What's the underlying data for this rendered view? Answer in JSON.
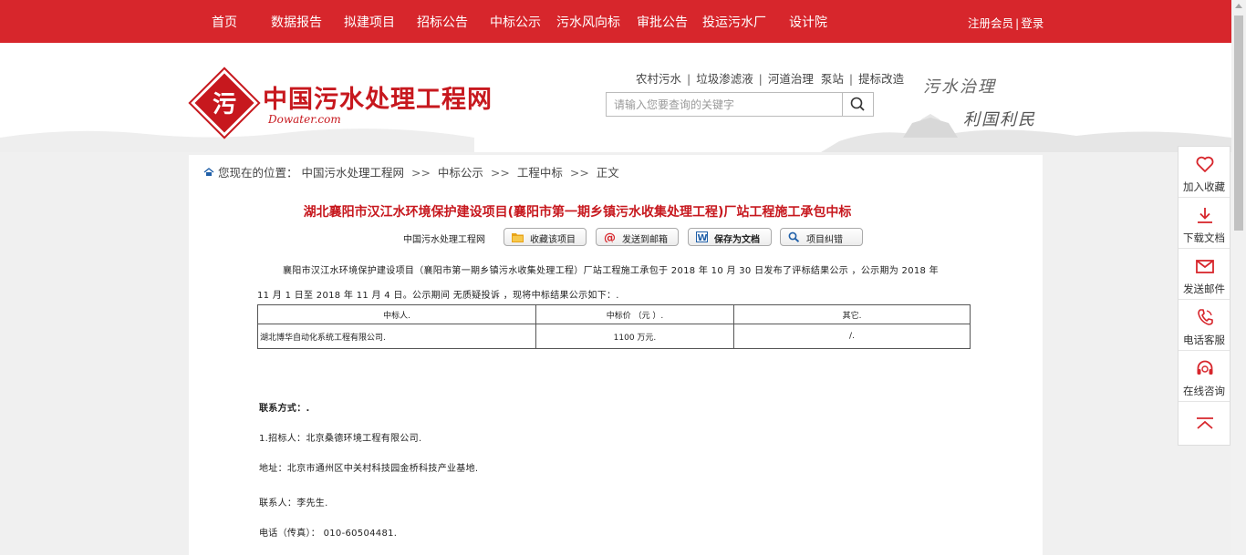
{
  "nav": {
    "items": [
      "首页",
      "数据报告",
      "拟建项目",
      "招标公告",
      "中标公示",
      "污水风向标",
      "审批公告",
      "投运污水厂",
      "设计院"
    ],
    "register": "注册会员",
    "sep": "|",
    "login": "登录"
  },
  "header": {
    "logo_char": "污",
    "site_name": "中国污水处理工程网",
    "domain": "Dowater.com",
    "quick_links": [
      "农村污水",
      "垃圾渗滤液",
      "河道治理",
      "泵站",
      "提标改造"
    ],
    "search_placeholder": "请输入您要查询的关键字",
    "slogan_line1": "污水治理",
    "slogan_line2": "利国利民"
  },
  "breadcrumb": {
    "prefix": "您现在的位置：",
    "items": [
      "中国污水处理工程网",
      "中标公示",
      "工程中标",
      "正文"
    ],
    "arrow": ">>"
  },
  "article": {
    "title": "湖北襄阳市汉江水环境保护建设项目(襄阳市第一期乡镇污水收集处理工程)厂站工程施工承包中标",
    "source": "中国污水处理工程网",
    "tools": [
      "收藏该项目",
      "发送到邮箱",
      "保存为文档",
      "项目纠错"
    ],
    "para1_line1": "襄阳市汉江水环境保护建设项目（襄阳市第一期乡镇污水收集处理工程）厂站工程施工承包于 2018 年 10 月 30 日发布了评标结果公示 ，公示期为 2018 年",
    "para1_line2": "11 月 1 日至 2018 年 11 月 4 日。公示期间 无质疑投诉 ，现将中标结果公示如下：.",
    "table": {
      "headers": [
        "中标人.",
        "中标价 （元 ）.",
        "其它."
      ],
      "row": [
        "湖北博华自动化系统工程有限公司.",
        "1100 万元.",
        "/."
      ]
    },
    "contact_title": "联系方式：.",
    "contact_lines": [
      "1.招标人：北京桑德环境工程有限公司.",
      "地址：北京市通州区中关村科技园金桥科技产业基地.",
      "联系人：李先生.",
      "电话（传真）：  010-60504481."
    ]
  },
  "side_panel": {
    "items": [
      {
        "label": "加入收藏",
        "icon": "heart-icon"
      },
      {
        "label": "下载文档",
        "icon": "download-icon"
      },
      {
        "label": "发送邮件",
        "icon": "mail-icon"
      },
      {
        "label": "电话客服",
        "icon": "phone-icon"
      },
      {
        "label": "在线咨询",
        "icon": "headset-icon"
      }
    ]
  },
  "colors": {
    "brand_red": "#d7262c",
    "title_red": "#c7181e"
  }
}
